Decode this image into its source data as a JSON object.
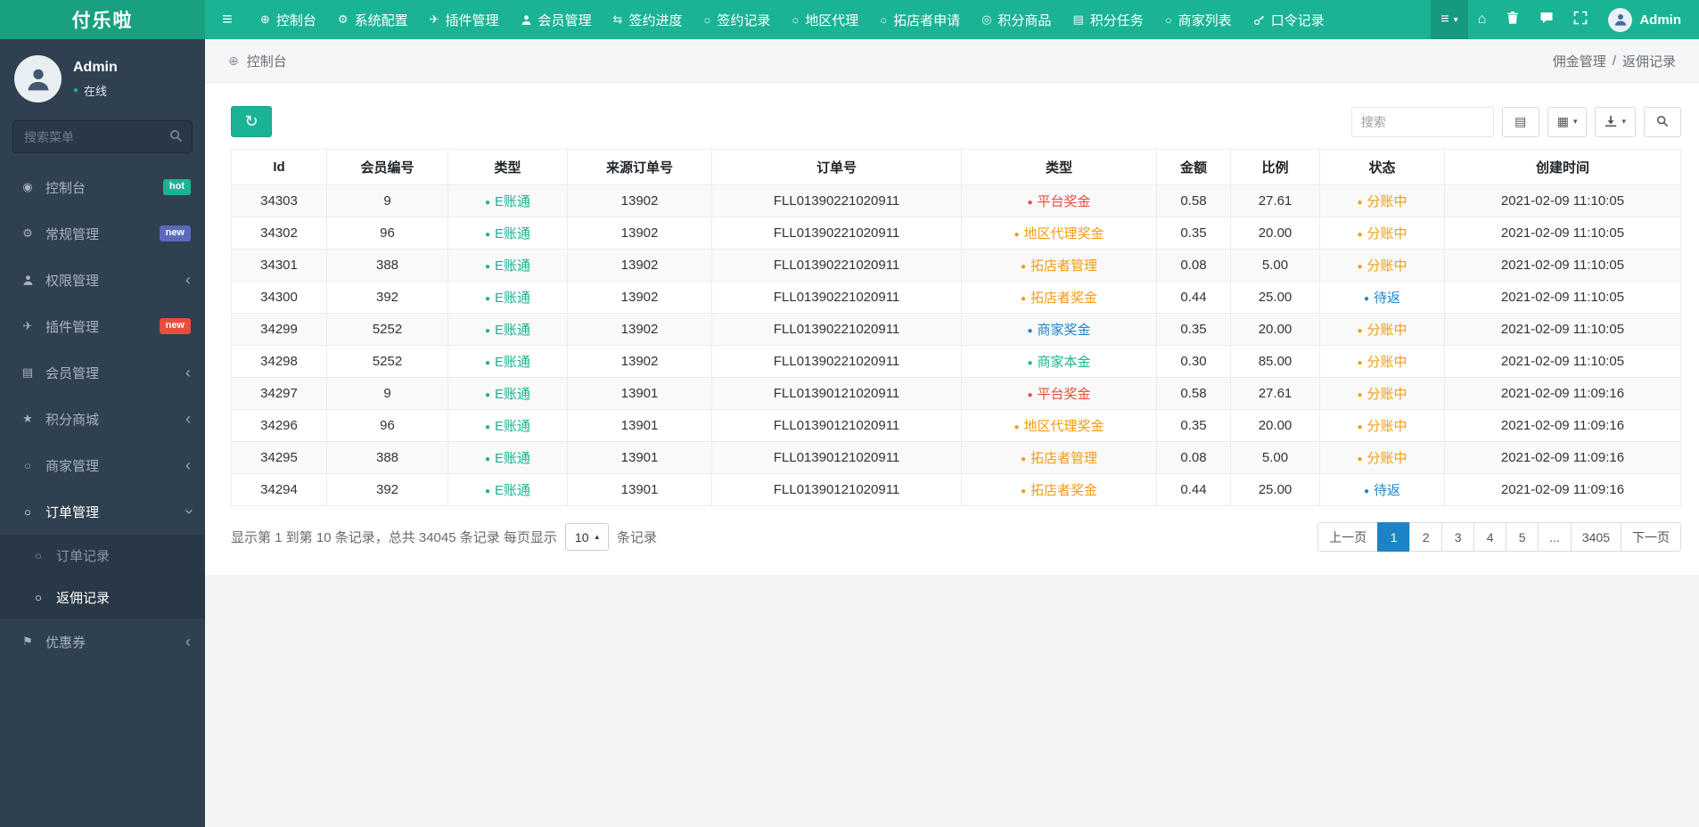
{
  "brand": "付乐啦",
  "topnav": {
    "items": [
      {
        "label": "控制台",
        "icon": "dashboard"
      },
      {
        "label": "系统配置",
        "icon": "gear"
      },
      {
        "label": "插件管理",
        "icon": "plane"
      },
      {
        "label": "会员管理",
        "icon": "user"
      },
      {
        "label": "签约进度",
        "icon": "exchange"
      },
      {
        "label": "签约记录",
        "icon": "circle"
      },
      {
        "label": "地区代理",
        "icon": "circle"
      },
      {
        "label": "拓店者申请",
        "icon": "circle"
      },
      {
        "label": "积分商品",
        "icon": "bullseye"
      },
      {
        "label": "积分任务",
        "icon": "list"
      },
      {
        "label": "商家列表",
        "icon": "circle"
      },
      {
        "label": "口令记录",
        "icon": "key"
      }
    ],
    "right_icons": [
      {
        "icon": "menu-list",
        "caret": true,
        "pressed": true
      },
      {
        "icon": "home",
        "caret": false,
        "pressed": false
      },
      {
        "icon": "trash",
        "caret": false,
        "pressed": false
      },
      {
        "icon": "message",
        "caret": false,
        "pressed": false
      },
      {
        "icon": "fullscreen",
        "caret": false,
        "pressed": false
      }
    ],
    "user": "Admin"
  },
  "sidebar": {
    "username": "Admin",
    "status": "在线",
    "search_placeholder": "搜索菜单",
    "items": [
      {
        "label": "控制台",
        "icon": "gauge",
        "badge": "hot",
        "badge_color": "#1ab394"
      },
      {
        "label": "常规管理",
        "icon": "gear",
        "badge": "new",
        "badge_color": "#5b69bc"
      },
      {
        "label": "权限管理",
        "icon": "user",
        "chevron": true
      },
      {
        "label": "插件管理",
        "icon": "plane",
        "badge": "new",
        "badge_color": "#e74c3c"
      },
      {
        "label": "会员管理",
        "icon": "list",
        "chevron": true
      },
      {
        "label": "积分商城",
        "icon": "star",
        "chevron": true
      },
      {
        "label": "商家管理",
        "icon": "circle",
        "chevron": true
      },
      {
        "label": "订单管理",
        "icon": "circle",
        "expanded": true,
        "children": [
          {
            "label": "订单记录",
            "active": false
          },
          {
            "label": "返佣记录",
            "active": true
          }
        ]
      },
      {
        "label": "优惠券",
        "icon": "bookmark",
        "chevron": true
      }
    ]
  },
  "breadcrumb": {
    "section": "控制台",
    "parent": "佣金管理",
    "separator": "/",
    "current": "返佣记录"
  },
  "toolbar": {
    "search_placeholder": "搜索",
    "buttons": [
      {
        "icon": "card-view",
        "caret": false
      },
      {
        "icon": "columns-grid",
        "caret": true
      },
      {
        "icon": "export-download",
        "caret": true
      },
      {
        "icon": "search",
        "caret": false
      }
    ]
  },
  "table": {
    "headers": [
      "Id",
      "会员编号",
      "类型",
      "来源订单号",
      "订单号",
      "类型",
      "金额",
      "比例",
      "状态",
      "创建时间"
    ],
    "rows": [
      {
        "id": "34303",
        "member_no": "9",
        "account_type": "E账通",
        "account_type_color": "green",
        "source_order_no": "13902",
        "order_no": "FLL01390221020911",
        "bonus_type": "平台奖金",
        "bonus_type_color": "red",
        "amount": "0.58",
        "ratio": "27.61",
        "status": "分账中",
        "status_color": "orange",
        "created_at": "2021-02-09 11:10:05"
      },
      {
        "id": "34302",
        "member_no": "96",
        "account_type": "E账通",
        "account_type_color": "green",
        "source_order_no": "13902",
        "order_no": "FLL01390221020911",
        "bonus_type": "地区代理奖金",
        "bonus_type_color": "orange",
        "amount": "0.35",
        "ratio": "20.00",
        "status": "分账中",
        "status_color": "orange",
        "created_at": "2021-02-09 11:10:05"
      },
      {
        "id": "34301",
        "member_no": "388",
        "account_type": "E账通",
        "account_type_color": "green",
        "source_order_no": "13902",
        "order_no": "FLL01390221020911",
        "bonus_type": "拓店者管理",
        "bonus_type_color": "orange",
        "amount": "0.08",
        "ratio": "5.00",
        "status": "分账中",
        "status_color": "orange",
        "created_at": "2021-02-09 11:10:05"
      },
      {
        "id": "34300",
        "member_no": "392",
        "account_type": "E账通",
        "account_type_color": "green",
        "source_order_no": "13902",
        "order_no": "FLL01390221020911",
        "bonus_type": "拓店者奖金",
        "bonus_type_color": "orange",
        "amount": "0.44",
        "ratio": "25.00",
        "status": "待返",
        "status_color": "blue",
        "created_at": "2021-02-09 11:10:05"
      },
      {
        "id": "34299",
        "member_no": "5252",
        "account_type": "E账通",
        "account_type_color": "green",
        "source_order_no": "13902",
        "order_no": "FLL01390221020911",
        "bonus_type": "商家奖金",
        "bonus_type_color": "blue",
        "amount": "0.35",
        "ratio": "20.00",
        "status": "分账中",
        "status_color": "orange",
        "created_at": "2021-02-09 11:10:05"
      },
      {
        "id": "34298",
        "member_no": "5252",
        "account_type": "E账通",
        "account_type_color": "green",
        "source_order_no": "13902",
        "order_no": "FLL01390221020911",
        "bonus_type": "商家本金",
        "bonus_type_color": "green",
        "amount": "0.30",
        "ratio": "85.00",
        "status": "分账中",
        "status_color": "orange",
        "created_at": "2021-02-09 11:10:05"
      },
      {
        "id": "34297",
        "member_no": "9",
        "account_type": "E账通",
        "account_type_color": "green",
        "source_order_no": "13901",
        "order_no": "FLL01390121020911",
        "bonus_type": "平台奖金",
        "bonus_type_color": "red",
        "amount": "0.58",
        "ratio": "27.61",
        "status": "分账中",
        "status_color": "orange",
        "created_at": "2021-02-09 11:09:16"
      },
      {
        "id": "34296",
        "member_no": "96",
        "account_type": "E账通",
        "account_type_color": "green",
        "source_order_no": "13901",
        "order_no": "FLL01390121020911",
        "bonus_type": "地区代理奖金",
        "bonus_type_color": "orange",
        "amount": "0.35",
        "ratio": "20.00",
        "status": "分账中",
        "status_color": "orange",
        "created_at": "2021-02-09 11:09:16"
      },
      {
        "id": "34295",
        "member_no": "388",
        "account_type": "E账通",
        "account_type_color": "green",
        "source_order_no": "13901",
        "order_no": "FLL01390121020911",
        "bonus_type": "拓店者管理",
        "bonus_type_color": "orange",
        "amount": "0.08",
        "ratio": "5.00",
        "status": "分账中",
        "status_color": "orange",
        "created_at": "2021-02-09 11:09:16"
      },
      {
        "id": "34294",
        "member_no": "392",
        "account_type": "E账通",
        "account_type_color": "green",
        "source_order_no": "13901",
        "order_no": "FLL01390121020911",
        "bonus_type": "拓店者奖金",
        "bonus_type_color": "orange",
        "amount": "0.44",
        "ratio": "25.00",
        "status": "待返",
        "status_color": "blue",
        "created_at": "2021-02-09 11:09:16"
      }
    ]
  },
  "pagination": {
    "info_prefix": "显示第 1 到第 10 条记录，总共 34045 条记录 每页显示",
    "page_size": "10",
    "info_suffix": "条记录",
    "prev_label": "上一页",
    "next_label": "下一页",
    "pages": [
      "1",
      "2",
      "3",
      "4",
      "5",
      "...",
      "3405"
    ],
    "active_page": "1"
  },
  "colors": {
    "green": "#1ab394",
    "red": "#e74c3c",
    "orange": "#f39c12",
    "blue": "#1c84c6",
    "topbar": "#1ab394",
    "sidebar": "#2f4050",
    "pagination_active": "#1c84c6"
  }
}
